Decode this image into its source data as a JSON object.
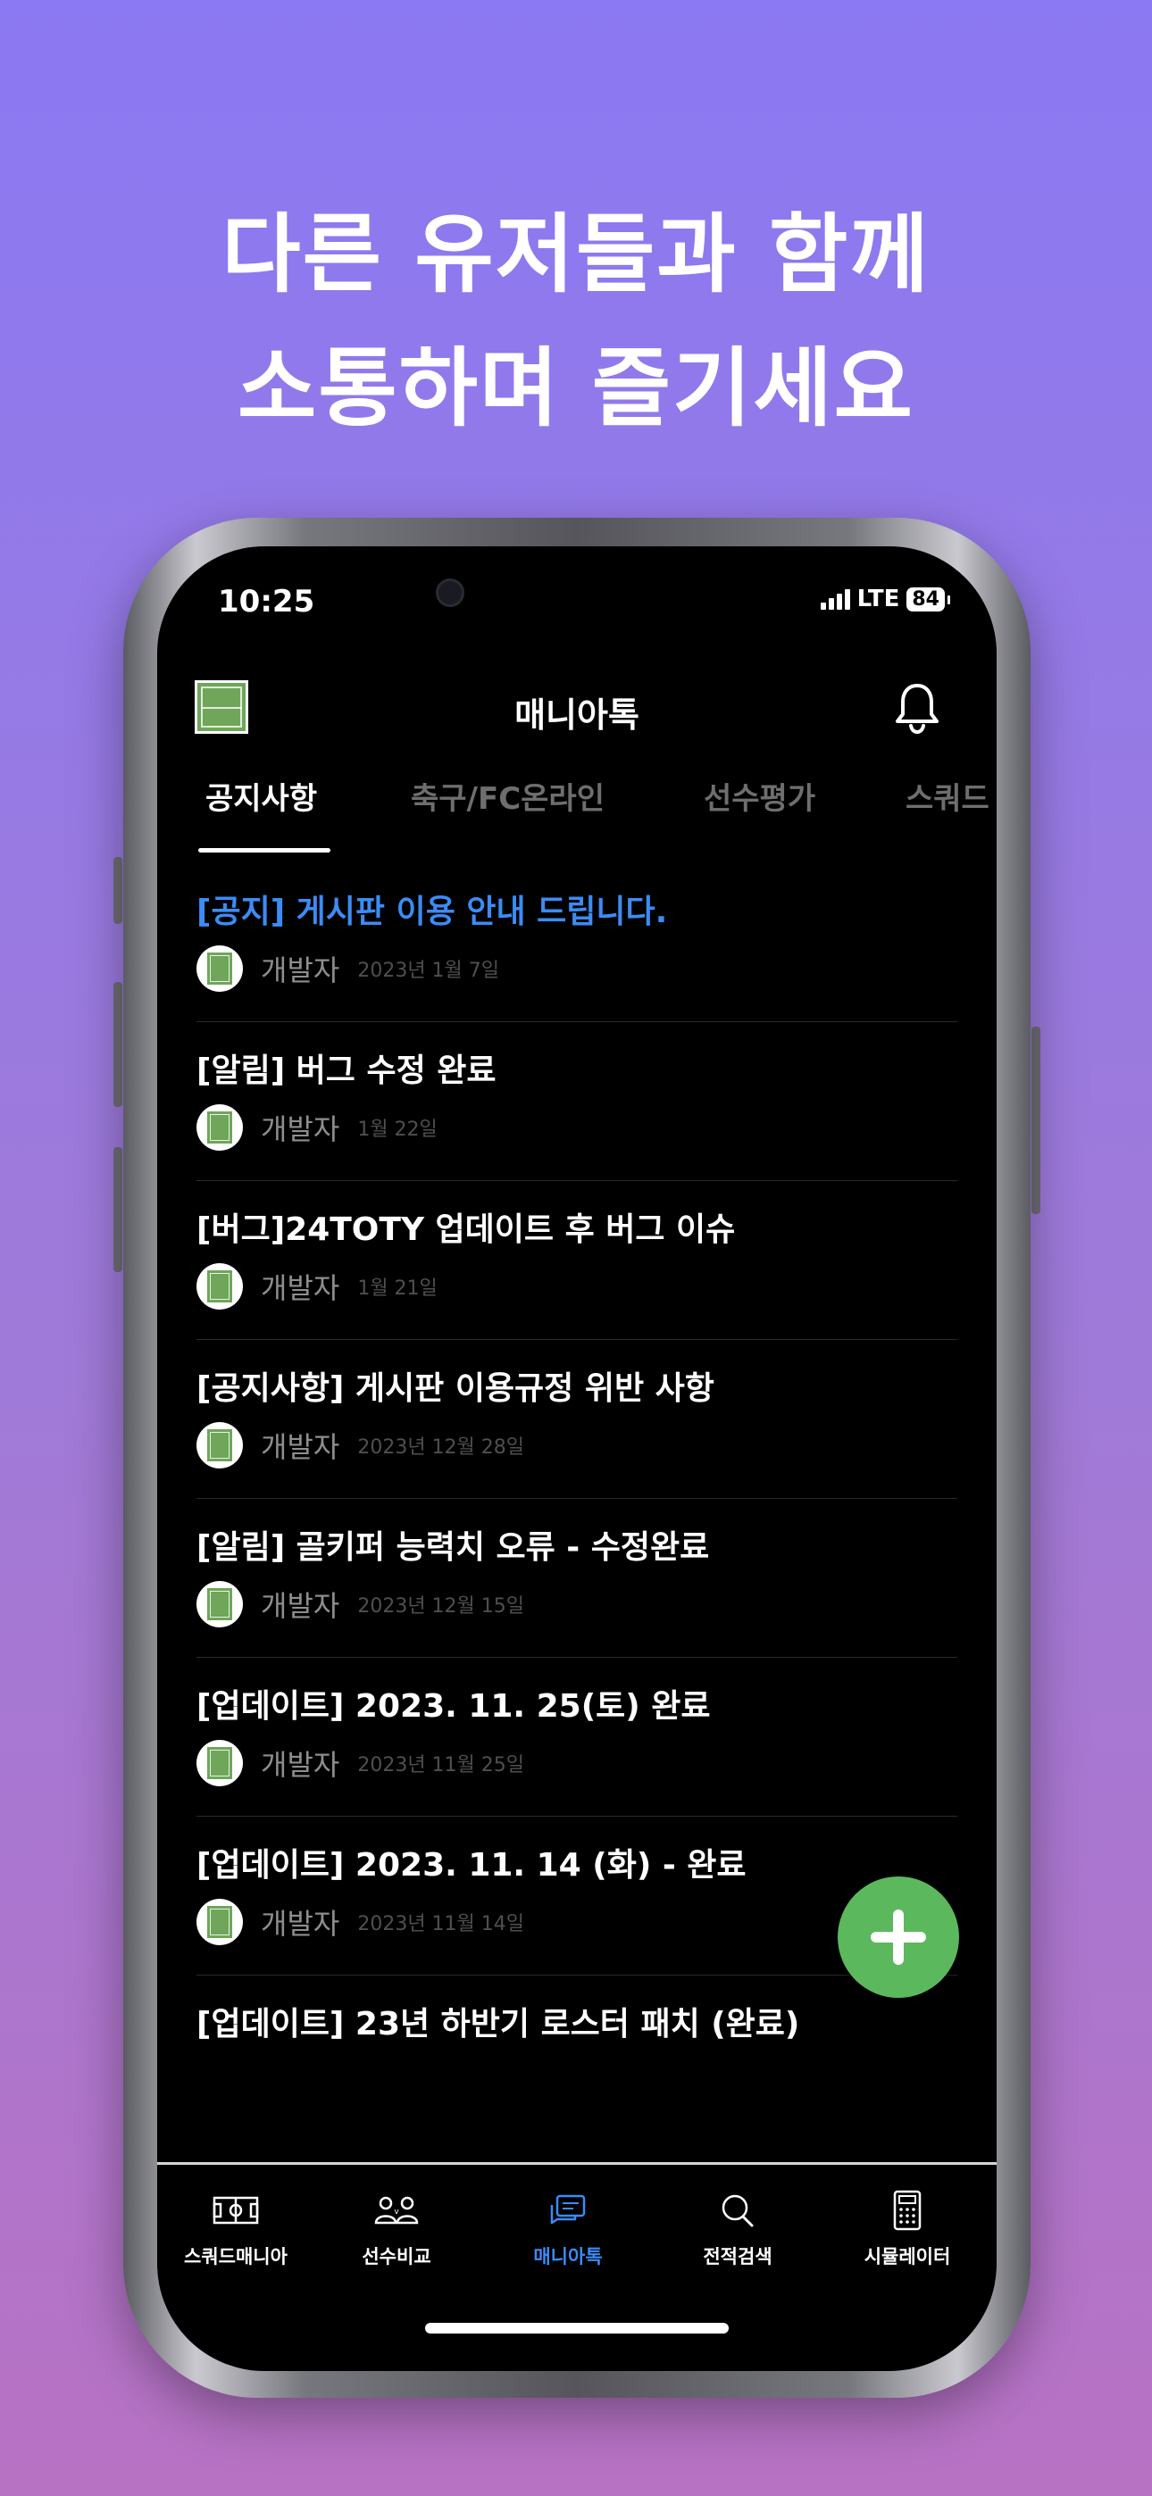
{
  "promo": {
    "line1": "다른 유저들과 함께",
    "line2": "소통하며 즐기세요"
  },
  "status_bar": {
    "time": "10:25",
    "network": "LTE",
    "battery": "84"
  },
  "app_bar": {
    "title": "매니아톡",
    "logo_icon": "soccer-pitch-icon",
    "notification_icon": "bell-icon"
  },
  "tabs": [
    {
      "label": "공지사항",
      "active": true
    },
    {
      "label": "축구/FC온라인",
      "active": false
    },
    {
      "label": "선수평가",
      "active": false
    },
    {
      "label": "스쿼드",
      "active": false
    }
  ],
  "posts": [
    {
      "title": "[공지] 게시판 이용 안내 드립니다.",
      "author": "개발자",
      "date": "2023년 1월 7일",
      "highlight": true
    },
    {
      "title": "[알림] 버그 수정 완료",
      "author": "개발자",
      "date": "1월 22일"
    },
    {
      "title": "[버그]24TOTY 업데이트 후 버그 이슈",
      "author": "개발자",
      "date": "1월 21일"
    },
    {
      "title": "[공지사항] 게시판 이용규정 위반 사항",
      "author": "개발자",
      "date": "2023년 12월 28일"
    },
    {
      "title": "[알림] 골키퍼 능력치 오류 - 수정완료",
      "author": "개발자",
      "date": "2023년 12월 15일"
    },
    {
      "title": "[업데이트] 2023. 11. 25(토) 완료",
      "author": "개발자",
      "date": "2023년 11월 25일"
    },
    {
      "title": "[업데이트] 2023. 11. 14 (화) - 완료",
      "author": "개발자",
      "date": "2023년 11월 14일"
    },
    {
      "title": "[업데이트] 23년 하반기 로스터 패치 (완료)",
      "author": "",
      "date": ""
    }
  ],
  "fab": {
    "icon": "plus-icon"
  },
  "bottom_nav": [
    {
      "label": "스쿼드매니아",
      "icon": "pitch-formation-icon",
      "active": false
    },
    {
      "label": "선수비교",
      "icon": "players-compare-icon",
      "active": false
    },
    {
      "label": "매니아톡",
      "icon": "chat-bubbles-icon",
      "active": true
    },
    {
      "label": "전적검색",
      "icon": "search-icon",
      "active": false
    },
    {
      "label": "시뮬레이터",
      "icon": "calculator-icon",
      "active": false
    }
  ],
  "colors": {
    "background_top": "#8b79f3",
    "background_bottom": "#b872c4",
    "accent_blue": "#3b8cf5",
    "fab_green": "#5cb85c"
  }
}
